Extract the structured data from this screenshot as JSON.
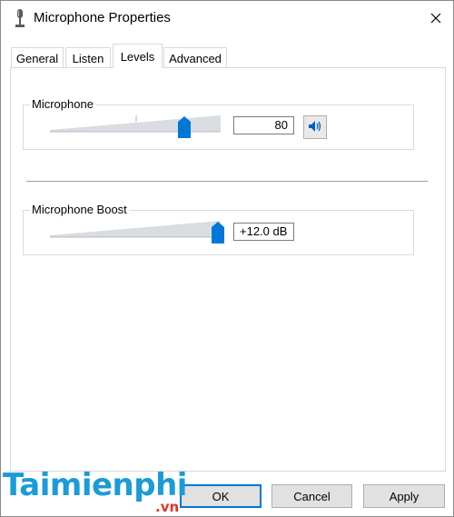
{
  "window": {
    "title": "Microphone Properties",
    "icon": "microphone-icon"
  },
  "tabs": [
    {
      "label": "General"
    },
    {
      "label": "Listen"
    },
    {
      "label": "Levels",
      "active": true
    },
    {
      "label": "Advanced"
    }
  ],
  "levels": {
    "microphone": {
      "label": "Microphone",
      "value": "80",
      "level_percent": 80,
      "mute_icon": "speaker-icon"
    },
    "boost": {
      "label": "Microphone Boost",
      "value": "+12.0 dB",
      "level_percent": 100
    }
  },
  "buttons": {
    "ok": "OK",
    "cancel": "Cancel",
    "apply": "Apply"
  },
  "watermark": {
    "brand": "Taimienphi",
    "suffix": ".vn"
  },
  "colors": {
    "accent": "#0078d7",
    "watermark": "#1b9bd7"
  }
}
